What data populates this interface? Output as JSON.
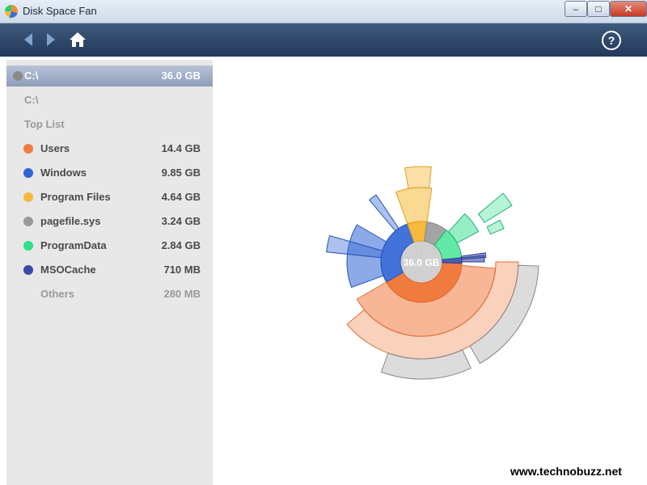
{
  "window": {
    "title": "Disk Space Fan",
    "minimize": "–",
    "maximize": "□",
    "close": "✕"
  },
  "toolbar": {
    "back_icon": "back-arrow-icon",
    "forward_icon": "forward-arrow-icon",
    "home_icon": "home-icon",
    "help_label": "?"
  },
  "sidebar": {
    "selected": {
      "name": "C:\\",
      "size": "36.0 GB"
    },
    "path": "C:\\",
    "section": "Top List",
    "items": [
      {
        "name": "Users",
        "size": "14.4 GB",
        "color": "#f07b3f"
      },
      {
        "name": "Windows",
        "size": "9.85 GB",
        "color": "#2f63d6"
      },
      {
        "name": "Program Files",
        "size": "4.64 GB",
        "color": "#f6b93b"
      },
      {
        "name": "pagefile.sys",
        "size": "3.24 GB",
        "color": "#9a9a9a"
      },
      {
        "name": "ProgramData",
        "size": "2.84 GB",
        "color": "#2ee08a"
      },
      {
        "name": "MSOCache",
        "size": "710 MB",
        "color": "#3a4aa8"
      }
    ],
    "others": {
      "name": "Others",
      "size": "280 MB"
    }
  },
  "chart_center_label": "36.0 GB",
  "watermark": "www.technobuzz.net"
}
